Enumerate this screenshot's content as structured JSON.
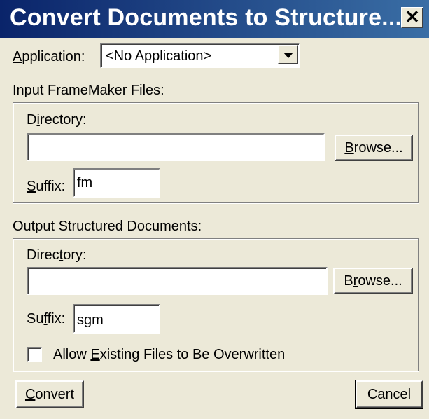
{
  "window": {
    "title": "Convert Documents to Structure...",
    "close_icon": "close-icon"
  },
  "application": {
    "label_prefix": "",
    "label_hotkey": "A",
    "label_rest": "pplication:",
    "selected": "<No Application>",
    "dropdown_icon": "chevron-down-icon"
  },
  "input": {
    "group_label": "Input FrameMaker Files:",
    "directory_label_pre": "D",
    "directory_label_hotkey": "i",
    "directory_label_post": "rectory:",
    "directory_value": "",
    "browse_pre": "",
    "browse_hotkey": "B",
    "browse_post": "rowse...",
    "suffix_pre": "",
    "suffix_hotkey": "S",
    "suffix_post": "uffix:",
    "suffix_value": "fm"
  },
  "output": {
    "group_label": "Output Structured Documents:",
    "directory_label_pre": "Direc",
    "directory_label_hotkey": "t",
    "directory_label_post": "ory:",
    "directory_value": "",
    "browse_pre": "B",
    "browse_hotkey": "r",
    "browse_post": "owse...",
    "suffix_pre": "Su",
    "suffix_hotkey": "f",
    "suffix_post": "fix:",
    "suffix_value": "sgm",
    "overwrite_pre": "Allow ",
    "overwrite_hotkey": "E",
    "overwrite_post": "xisting Files to Be Overwritten",
    "overwrite_checked": false
  },
  "buttons": {
    "convert_pre": "",
    "convert_hotkey": "C",
    "convert_post": "onvert",
    "cancel": "Cancel"
  }
}
